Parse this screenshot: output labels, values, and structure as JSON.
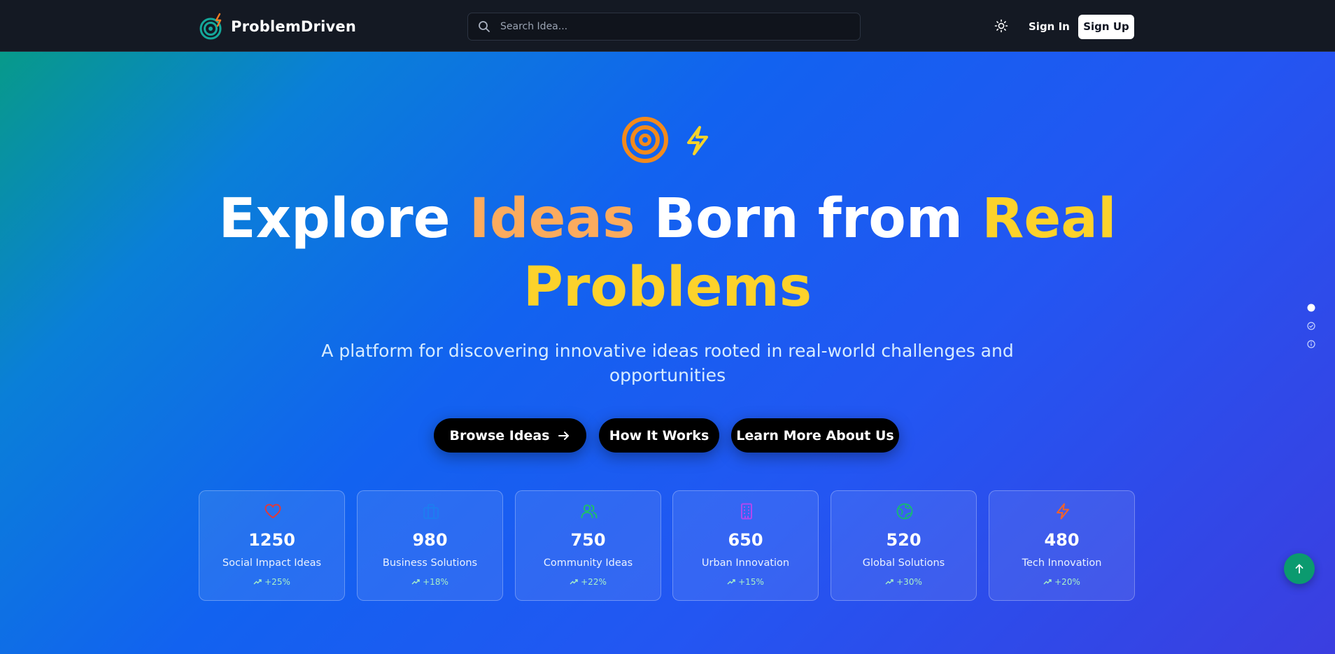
{
  "nav": {
    "brand": "ProblemDriven",
    "search_placeholder": "Search Idea...",
    "sign_in": "Sign In",
    "sign_up": "Sign Up",
    "icons": {
      "logo": "target-bolt-icon",
      "search": "search-icon",
      "theme": "sun-icon"
    }
  },
  "hero": {
    "headline": {
      "part1": "Explore ",
      "part2": "Ideas",
      "part3": " Born from ",
      "part4": "Real",
      "part5": "Problems"
    },
    "subtitle": "A platform for discovering innovative ideas rooted in real-world challenges and opportunities",
    "buttons": {
      "browse": "Browse Ideas",
      "how": "How It Works",
      "learn": "Learn More About Us"
    }
  },
  "categories": [
    {
      "count": "1250",
      "label": "Social Impact Ideas",
      "growth": "+25%",
      "icon": "heart-icon",
      "color": "#e03a3a"
    },
    {
      "count": "980",
      "label": "Business Solutions",
      "growth": "+18%",
      "icon": "briefcase-icon",
      "color": "#1e7cf0"
    },
    {
      "count": "750",
      "label": "Community Ideas",
      "growth": "+22%",
      "icon": "users-icon",
      "color": "#1fbf6a"
    },
    {
      "count": "650",
      "label": "Urban Innovation",
      "growth": "+15%",
      "icon": "building-icon",
      "color": "#b048f0"
    },
    {
      "count": "520",
      "label": "Global Solutions",
      "growth": "+30%",
      "icon": "globe-icon",
      "color": "#18b57a"
    },
    {
      "count": "480",
      "label": "Tech Innovation",
      "growth": "+20%",
      "icon": "bolt-icon",
      "color": "#f2622a"
    }
  ],
  "colors": {
    "accent_orange": "#fbab5e",
    "accent_yellow": "#fcd22b",
    "navbar": "#141923",
    "fab": "#0b9a6f"
  }
}
